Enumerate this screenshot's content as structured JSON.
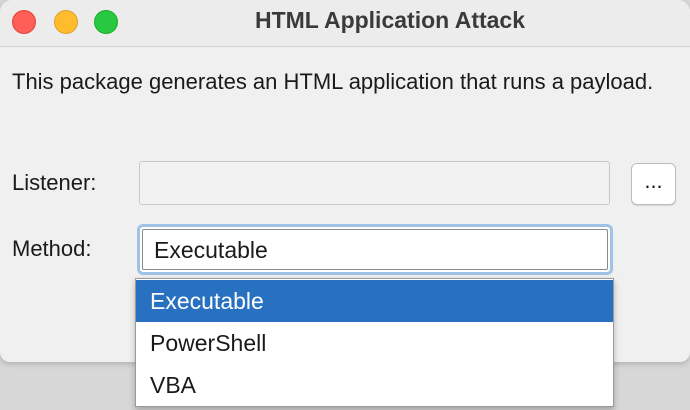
{
  "window": {
    "title": "HTML Application Attack"
  },
  "description": "This package generates an HTML application that runs a payload.",
  "form": {
    "listener_label": "Listener:",
    "listener_value": "",
    "browse_label": "...",
    "method_label": "Method:",
    "method_value": "Executable"
  },
  "dropdown": {
    "options": [
      "Executable",
      "PowerShell",
      "VBA"
    ],
    "selected_index": 0
  },
  "colors": {
    "selection": "#2771c0",
    "focus_ring": "#9fc2e6",
    "close": "#ff5f57",
    "minimize": "#febc2e",
    "zoom": "#28c840"
  }
}
